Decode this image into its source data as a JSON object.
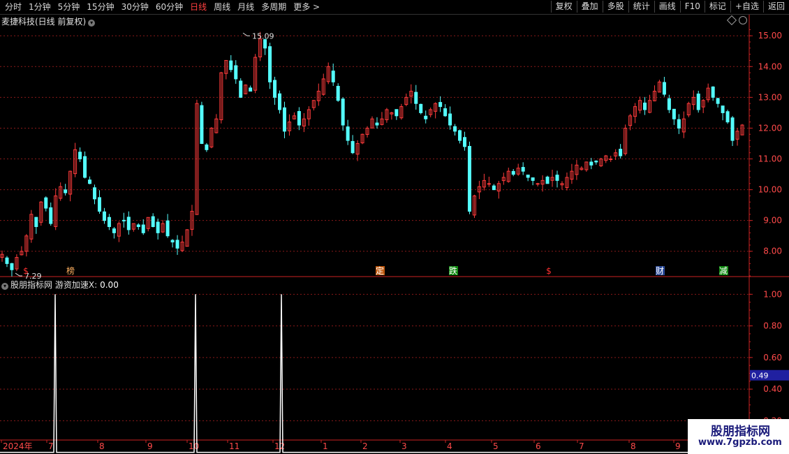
{
  "toolbar": {
    "periods": [
      "分时",
      "1分钟",
      "5分钟",
      "15分钟",
      "30分钟",
      "60分钟",
      "日线",
      "周线",
      "月线",
      "多周期",
      "更多"
    ],
    "active_period": "日线",
    "actions": [
      "复权",
      "叠加",
      "多股",
      "统计",
      "画线",
      "F10",
      "标记",
      "+自选",
      "返回"
    ]
  },
  "main_panel": {
    "title": "麦捷科技(日线 前复权)",
    "high_label": "15.09",
    "low_label": "7.29",
    "markers": [
      {
        "text": "$",
        "color": "#ff3030",
        "bg": "none"
      },
      {
        "text": "榜",
        "color": "#ffb060",
        "bg": "none"
      },
      {
        "text": "定",
        "color": "#ffffff",
        "bg": "#c05a10"
      },
      {
        "text": "跌",
        "color": "#ffffff",
        "bg": "#108a10"
      },
      {
        "text": "$",
        "color": "#ff3030",
        "bg": "none"
      },
      {
        "text": "财",
        "color": "#ffffff",
        "bg": "#2a4a9a"
      },
      {
        "text": "减",
        "color": "#ffffff",
        "bg": "#108a10"
      }
    ]
  },
  "sub_panel": {
    "title": "股朋指标网",
    "indicator": "游资加速X:",
    "value": "0.00",
    "current_tag": "0.49"
  },
  "x_axis": {
    "labels": [
      "2024年",
      "7",
      "8",
      "9",
      "10",
      "11",
      "12",
      "1",
      "2",
      "3",
      "4",
      "5",
      "6",
      "7",
      "8",
      "9"
    ]
  },
  "watermark": {
    "line1": "股朋指标网",
    "line2": "www.7gpzb.com"
  },
  "colors": {
    "up": "#ff3b3b",
    "down": "#54ffff",
    "grid": "#8a1a1a",
    "axis": "#cc2222",
    "signal": "#ffffff"
  },
  "chart_data": [
    {
      "type": "candlestick",
      "ylim": [
        7.2,
        15.3
      ],
      "yticks": [
        8.0,
        9.0,
        10.0,
        11.0,
        12.0,
        13.0,
        14.0,
        15.0
      ],
      "series": [
        {
          "name": "price",
          "close_path": [
            7.9,
            7.6,
            7.4,
            7.8,
            8.0,
            8.5,
            9.2,
            8.8,
            9.6,
            9.4,
            8.9,
            9.8,
            10.1,
            9.9,
            10.6,
            11.3,
            11.0,
            10.4,
            10.2,
            9.7,
            9.3,
            9.0,
            8.8,
            8.6,
            8.9,
            9.0,
            8.7,
            8.9,
            8.8,
            8.6,
            9.1,
            8.8,
            8.6,
            8.9,
            8.5,
            8.3,
            8.1,
            8.3,
            8.7,
            9.3,
            12.8,
            11.5,
            11.3,
            12.0,
            12.3,
            13.8,
            14.2,
            13.9,
            13.6,
            13.0,
            13.4,
            13.2,
            14.3,
            14.9,
            14.6,
            13.5,
            13.0,
            12.6,
            11.9,
            12.2,
            12.4,
            12.1,
            12.3,
            12.6,
            12.9,
            13.2,
            13.6,
            14.0,
            13.5,
            12.9,
            12.1,
            11.6,
            11.2,
            11.5,
            11.8,
            12.0,
            12.3,
            12.1,
            12.3,
            12.6,
            12.5,
            12.4,
            12.7,
            13.0,
            13.2,
            12.8,
            12.5,
            12.3,
            12.6,
            12.8,
            12.7,
            12.4,
            12.1,
            11.9,
            11.6,
            11.4,
            9.3,
            9.8,
            10.1,
            10.3,
            10.2,
            10.0,
            10.2,
            10.4,
            10.6,
            10.5,
            10.7,
            10.6,
            10.4,
            10.3,
            10.2,
            10.3,
            10.2,
            10.4,
            10.3,
            10.2,
            10.4,
            10.6,
            10.8,
            10.7,
            10.9,
            10.8,
            10.9,
            11.0,
            11.1,
            11.0,
            11.2,
            11.1,
            12.0,
            12.4,
            12.7,
            12.9,
            12.6,
            12.9,
            13.2,
            13.5,
            13.1,
            12.6,
            12.3,
            12.0,
            12.3,
            12.8,
            13.0,
            12.6,
            12.9,
            13.3,
            13.0,
            12.8,
            12.5,
            12.2,
            11.6,
            11.9,
            12.1
          ],
          "high": 15.09,
          "low": 7.29
        }
      ]
    },
    {
      "type": "line",
      "name": "游资加速X",
      "ylim": [
        0.1,
        1.05
      ],
      "yticks": [
        0.2,
        0.4,
        0.6,
        0.8,
        1.0
      ],
      "spikes_at_label_index": [
        1,
        4,
        6
      ],
      "spike_value": 1.0,
      "base_value": 0.0
    }
  ]
}
